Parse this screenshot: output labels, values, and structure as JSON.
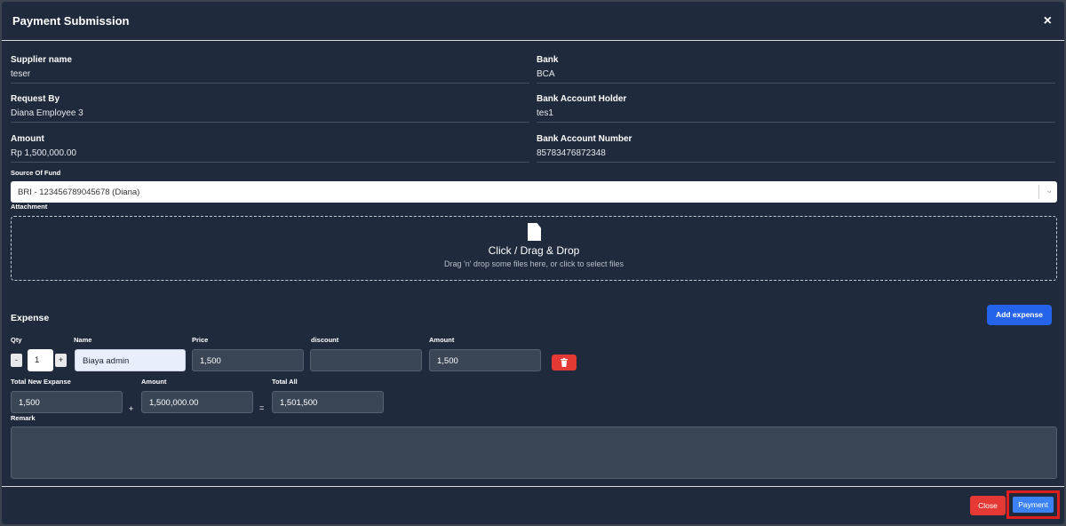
{
  "modal": {
    "title": "Payment Submission",
    "close_symbol": "×"
  },
  "info_left": [
    {
      "label": "Supplier name",
      "value": "teser"
    },
    {
      "label": "Request By",
      "value": "Diana Employee 3"
    },
    {
      "label": "Amount",
      "value": "Rp 1,500,000.00"
    }
  ],
  "info_right": [
    {
      "label": "Bank",
      "value": "BCA"
    },
    {
      "label": "Bank Account Holder",
      "value": "tes1"
    },
    {
      "label": "Bank Account Number",
      "value": "85783476872348"
    }
  ],
  "source_of_fund": {
    "label": "Source Of Fund",
    "value": "BRI - 123456789045678 (Diana)",
    "chevron": "⌄"
  },
  "attachment": {
    "label": "Attachment",
    "title": "Click / Drag & Drop",
    "hint": "Drag 'n' drop some files here, or click to select files"
  },
  "expense": {
    "title": "Expense",
    "add_label": "Add expense",
    "columns": {
      "qty": "Qty",
      "name": "Name",
      "price": "Price",
      "discount": "discount",
      "amount": "Amount"
    },
    "row": {
      "minus": "-",
      "qty": "1",
      "plus": "+",
      "name": "Biaya admin",
      "price": "1,500",
      "discount": "",
      "amount": "1,500"
    }
  },
  "totals": {
    "total_new_label": "Total New Expanse",
    "total_new_value": "1,500",
    "plus": "+",
    "amount_label": "Amount",
    "amount_value": "1,500,000.00",
    "equals": "=",
    "total_all_label": "Total All",
    "total_all_value": "1,501,500"
  },
  "remark": {
    "label": "Remark",
    "value": ""
  },
  "footer": {
    "close_label": "Close",
    "payment_label": "Payment"
  },
  "colors": {
    "background": "#1f2a3c",
    "primary": "#2563eb",
    "danger": "#e53935",
    "highlight": "#e01e1e"
  }
}
